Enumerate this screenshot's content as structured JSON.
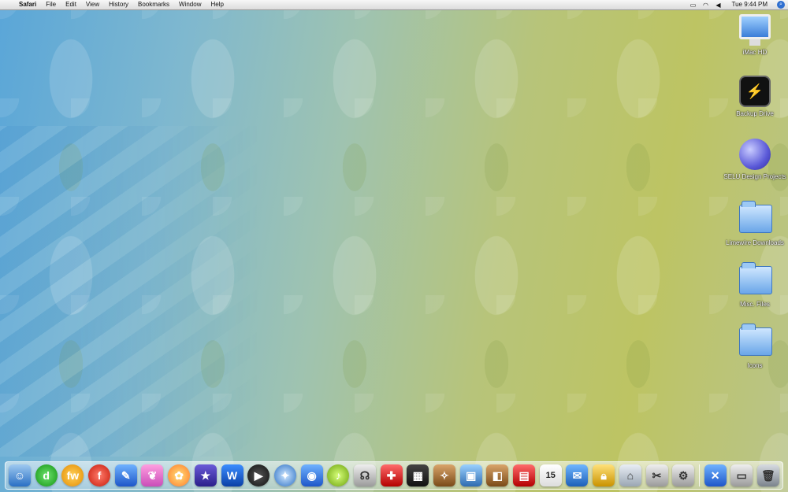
{
  "menubar": {
    "app": "Safari",
    "menus": [
      "File",
      "Edit",
      "View",
      "History",
      "Bookmarks",
      "Window",
      "Help"
    ],
    "clock": "Tue 9:44 PM"
  },
  "desktop": {
    "icons": [
      {
        "label": "iMac HD"
      },
      {
        "label": "Backup Drive"
      },
      {
        "label": "SELU Design Projects"
      },
      {
        "label": "Limewire Downloads"
      },
      {
        "label": "Misc. Files"
      },
      {
        "label": "Icons"
      }
    ]
  },
  "dock": {
    "calendar_day": "15",
    "items": [
      {
        "icon": "finder-icon"
      },
      {
        "icon": "dreamweaver-icon"
      },
      {
        "icon": "fireworks-icon"
      },
      {
        "icon": "flash-icon"
      },
      {
        "icon": "feather-icon"
      },
      {
        "icon": "butterfly-icon"
      },
      {
        "icon": "flower-icon"
      },
      {
        "icon": "star-icon"
      },
      {
        "icon": "word-icon"
      },
      {
        "icon": "ichat-icon"
      },
      {
        "icon": "safari-icon"
      },
      {
        "icon": "globe-icon"
      },
      {
        "icon": "itunes-icon"
      },
      {
        "icon": "headphones-icon"
      },
      {
        "icon": "acrobat-icon"
      },
      {
        "icon": "imovie-icon"
      },
      {
        "icon": "lock-icon"
      },
      {
        "icon": "iphoto-icon"
      },
      {
        "icon": "preview-icon"
      },
      {
        "icon": "film-icon"
      },
      {
        "icon": "ical-icon"
      },
      {
        "icon": "mail-icon"
      },
      {
        "icon": "keychain-icon"
      },
      {
        "icon": "home-icon"
      },
      {
        "icon": "utility-icon"
      },
      {
        "icon": "apple-settings-icon"
      },
      {
        "icon": "applications-icon"
      },
      {
        "icon": "documents-icon"
      },
      {
        "icon": "trash-icon"
      }
    ]
  }
}
